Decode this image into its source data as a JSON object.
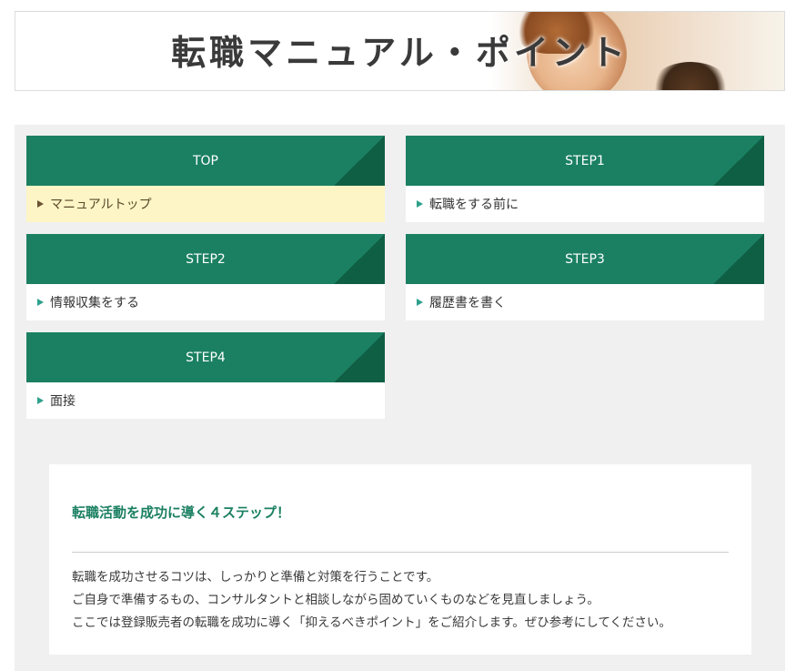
{
  "banner": {
    "title": "転職マニュアル・ポイント"
  },
  "cards": [
    {
      "heading": "TOP",
      "link": "マニュアルトップ"
    },
    {
      "heading": "STEP1",
      "link": "転職をする前に"
    },
    {
      "heading": "STEP2",
      "link": "情報収集をする"
    },
    {
      "heading": "STEP3",
      "link": "履歴書を書く"
    },
    {
      "heading": "STEP4",
      "link": "面接"
    }
  ],
  "info": {
    "title": "転職活動を成功に導く４ステップ！",
    "lines": [
      "転職を成功させるコツは、しっかりと準備と対策を行うことです。",
      "ご自身で準備するもの、コンサルタントと相談しながら固めていくものなどを見直しましょう。",
      "ここでは登録販売者の転職を成功に導く「抑えるべきポイント」をご紹介します。ぜひ参考にしてください。"
    ]
  },
  "colors": {
    "accent": "#1b8062",
    "accent_dark": "#0f5f44",
    "active_bg": "#fdf5c6",
    "panel_bg": "#f0f0f0"
  }
}
